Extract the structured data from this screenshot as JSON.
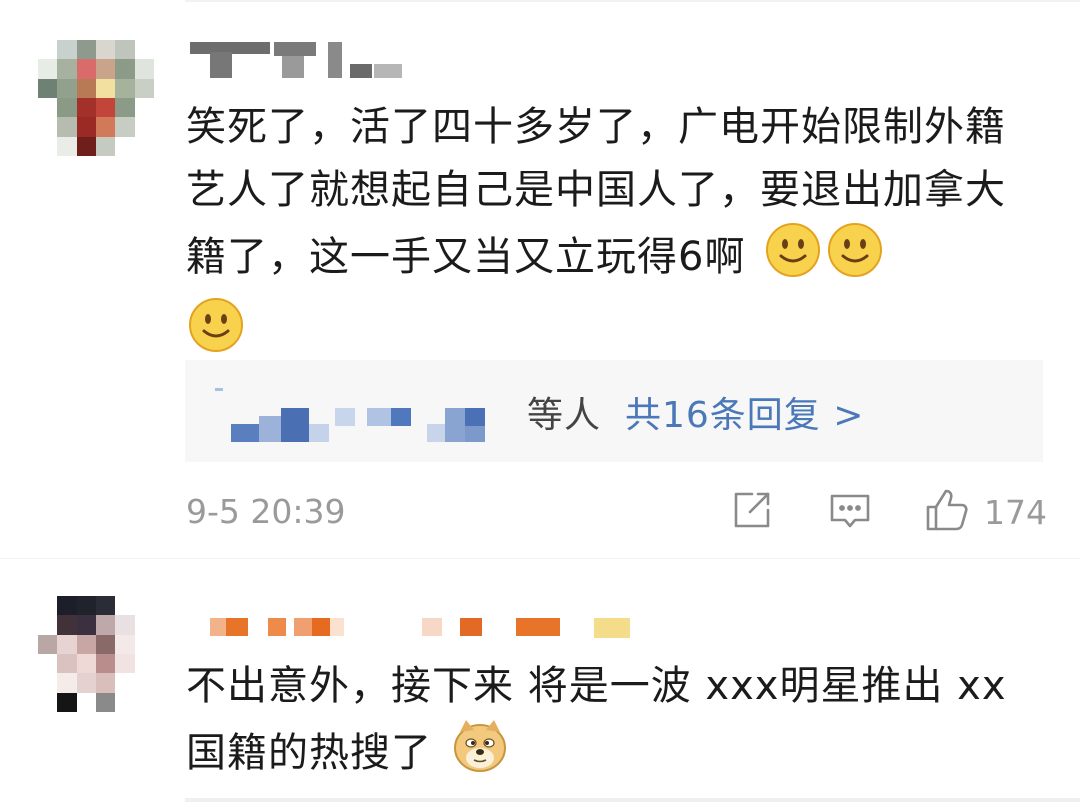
{
  "comments": [
    {
      "text": "笑死了，活了四十多岁了，广电开始限制外籍艺人了就想起自己是中国人了，要退出加拿大籍了，这一手又当又立玩得6啊",
      "emoji": [
        "smile-emoji",
        "smile-emoji",
        "smile-emoji"
      ],
      "replies": {
        "tail": "等人",
        "link": "共16条回复 >"
      },
      "timestamp": "9-5 20:39",
      "likes": "174"
    },
    {
      "text": "不出意外，接下来 将是一波 xxx明星推出 xx国籍的热搜了",
      "emoji": [
        "doge-emoji"
      ]
    }
  ],
  "icons": {
    "share": "share-icon",
    "comment": "comment-icon",
    "like": "thumbs-up-icon"
  },
  "colors": {
    "link": "#4a78b8",
    "meta": "#9a9a9a",
    "reply_bg": "#f7f7f7",
    "username2": "#e8742a"
  }
}
